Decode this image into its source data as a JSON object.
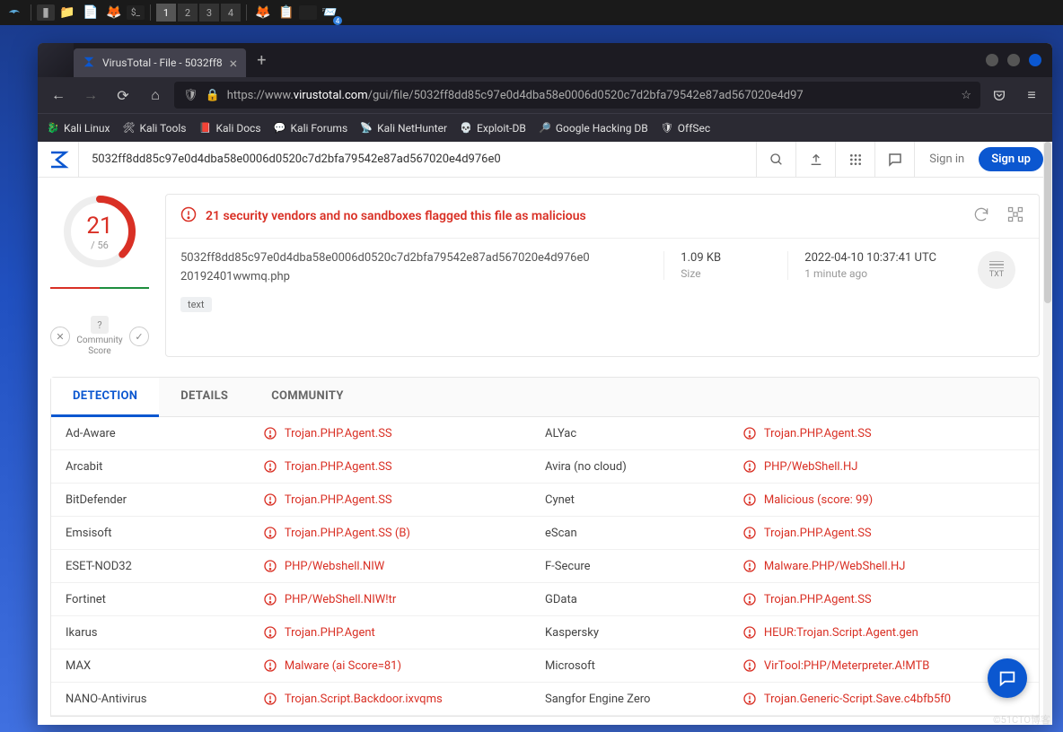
{
  "taskbar": {
    "workspaces": [
      "1",
      "2",
      "3",
      "4"
    ],
    "active_workspace": 0,
    "tray_count": "4"
  },
  "browser": {
    "tab_title": "VirusTotal - File - 5032ff8",
    "url_prefix": "https://www.",
    "url_domain": "virustotal.com",
    "url_path": "/gui/file/5032ff8dd85c97e0d4dba58e0006d0520c7d2bfa79542e87ad567020e4d97",
    "bookmarks": [
      "Kali Linux",
      "Kali Tools",
      "Kali Docs",
      "Kali Forums",
      "Kali NetHunter",
      "Exploit-DB",
      "Google Hacking DB",
      "OffSec"
    ]
  },
  "vt": {
    "search_value": "5032ff8dd85c97e0d4dba58e0006d0520c7d2bfa79542e87ad567020e4d976e0",
    "signin": "Sign in",
    "signup": "Sign up",
    "score_num": "21",
    "score_den": "/ 56",
    "community_label": "Community Score",
    "alert": "21 security vendors and no sandboxes flagged this file as malicious",
    "hash": "5032ff8dd85c97e0d4dba58e0006d0520c7d2bfa79542e87ad567020e4d976e0",
    "filename": "20192401wwmq.php",
    "tag": "text",
    "size_val": "1.09 KB",
    "size_lbl": "Size",
    "time_val": "2022-04-10 10:37:41 UTC",
    "time_lbl": "1 minute ago",
    "filetype": "TXT",
    "tabs": [
      "DETECTION",
      "DETAILS",
      "COMMUNITY"
    ],
    "active_tab": 0,
    "detections": [
      {
        "v1": "Ad-Aware",
        "r1": "Trojan.PHP.Agent.SS",
        "v2": "ALYac",
        "r2": "Trojan.PHP.Agent.SS"
      },
      {
        "v1": "Arcabit",
        "r1": "Trojan.PHP.Agent.SS",
        "v2": "Avira (no cloud)",
        "r2": "PHP/WebShell.HJ"
      },
      {
        "v1": "BitDefender",
        "r1": "Trojan.PHP.Agent.SS",
        "v2": "Cynet",
        "r2": "Malicious (score: 99)"
      },
      {
        "v1": "Emsisoft",
        "r1": "Trojan.PHP.Agent.SS (B)",
        "v2": "eScan",
        "r2": "Trojan.PHP.Agent.SS"
      },
      {
        "v1": "ESET-NOD32",
        "r1": "PHP/Webshell.NIW",
        "v2": "F-Secure",
        "r2": "Malware.PHP/WebShell.HJ"
      },
      {
        "v1": "Fortinet",
        "r1": "PHP/WebShell.NIW!tr",
        "v2": "GData",
        "r2": "Trojan.PHP.Agent.SS"
      },
      {
        "v1": "Ikarus",
        "r1": "Trojan.PHP.Agent",
        "v2": "Kaspersky",
        "r2": "HEUR:Trojan.Script.Agent.gen"
      },
      {
        "v1": "MAX",
        "r1": "Malware (ai Score=81)",
        "v2": "Microsoft",
        "r2": "VirTool:PHP/Meterpreter.A!MTB"
      },
      {
        "v1": "NANO-Antivirus",
        "r1": "Trojan.Script.Backdoor.ixvqms",
        "v2": "Sangfor Engine Zero",
        "r2": "Trojan.Generic-Script.Save.c4bfb5f0"
      }
    ]
  },
  "watermark": "©51CTO博客"
}
